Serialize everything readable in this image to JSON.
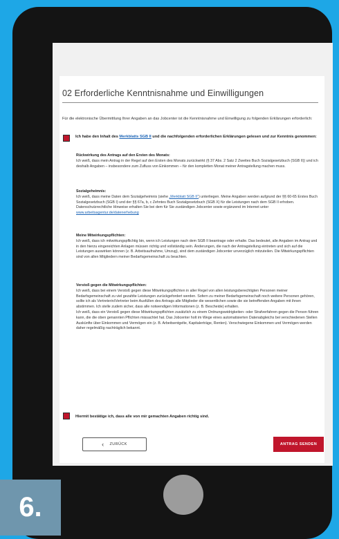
{
  "section": {
    "title": "02 Erforderliche Kenntnisnahme und Einwilligungen"
  },
  "intro": "Für die elektronische Übermittlung Ihrer Angaben an das Jobcenter ist die Kenntnisnahme und Einwilligung zu folgenden Erklärungen erforderlich:",
  "consent": {
    "pre": "Ich habe den Inhalt des ",
    "link": "Merkblatts SGB II",
    "post": " und die nachfolgenden erforderlichen Erklärungen gelesen und zur Kenntnis genommen:"
  },
  "blocks": {
    "rueckwirkung": {
      "heading": "Rückwirkung des Antrags auf den Ersten des Monats:",
      "text": "Ich weiß, dass mein Antrag in der Regel auf den Ersten des Monats zurückwirkt (§ 37 Abs. 2 Satz 2 Zweites Buch Sozialgesetzbuch (SGB II)) und ich deshalb Angaben – insbesondere zum Zufluss von Einkommen – für den kompletten Monat meiner Antragstellung machen muss."
    },
    "sozialgeheimnis": {
      "heading": "Sozialgeheimnis:",
      "text1": "Ich weiß, dass meine Daten dem Sozialgeheimnis (siehe ",
      "link1": "„Merkblatt SGB II“",
      "text2": ") unterliegen. Meine Angaben werden aufgrund der §§ 60-65 Erstes Buch Sozialgesetzbuch (SGB I) und der §§ 67a, b, c Zehntes Buch Sozialgesetzbuch (SGB X) für die Leistungen nach dem SGB II erhoben. Datenschutzrechtliche Hinweise erhalten Sie bei dem für Sie zuständigen Jobcenter sowie ergänzend im Internet unter ",
      "link2": "www.arbeitsagentur.de/datenerhebung"
    },
    "mitwirkung": {
      "heading": "Meine Mitwirkungspflichten:",
      "text": "Ich weiß, dass ich mitwirkungspflichtig bin, wenn ich Leistungen nach dem SGB II beantrage oder erhalte. Das bedeutet, alle Angaben im Antrag und in den hierzu eingereichten Anlagen müssen richtig und vollständig sein. Änderungen, die nach der Antragstellung eintreten und sich auf die Leistungen auswirken können (z. B. Arbeitsaufnahme, Umzug), sind dem zuständigen Jobcenter unverzüglich mitzuteilen. Die Mitwirkungspflichten sind von allen Mitgliedern meiner Bedarfsgemeinschaft zu beachten."
    },
    "verstoss": {
      "heading": "Verstoß gegen die Mitwirkungspflichten:",
      "text1": "Ich weiß, dass bei einem Verstoß gegen diese Mitwirkungspflichten in aller Regel von allen leistungsberechtigten Personen meiner Bedarfsgemeinschaft zu viel gezahlte Leistungen zurückgefordert werden. Sofern zu meiner Bedarfsgemeinschaft noch weitere Personen gehören, sollte ich als Vertreterin/Vertreter beim Ausfüllen des Antrags alle Mitglieder die wesentlichen sowie die sie betreffenden Angaben mit ihnen abstimmen. Ich stelle zudem sicher, dass alle notwendigen Informationen (z. B. Bescheide) erhalten.",
      "text2": "Ich weiß, dass ein Verstoß gegen diese Mitwirkungspflichten zusätzlich zu einem Ordnungswidrigkeiten- oder Strafverfahren gegen die Person führen kann, die die oben genannten Pflichten missachtet hat. Das Jobcenter holt im Wege eines automatisierten Datenabgleichs bei verschiedenen Stellen Auskünfte über Einkommen und Vermögen ein (z. B. Arbeitsentgelte, Kapitalerträge, Renten). Verschwiegene Einkommen und Vermögen werden daher regelmäßig nachträglich bekannt."
    }
  },
  "confirm": "Hiermit bestätige ich, dass alle von mir gemachten Angaben richtig sind.",
  "buttons": {
    "back": "ZURÜCK",
    "back_icon": "‹",
    "send": "ANTRAG SENDEN"
  },
  "step_badge": "6."
}
